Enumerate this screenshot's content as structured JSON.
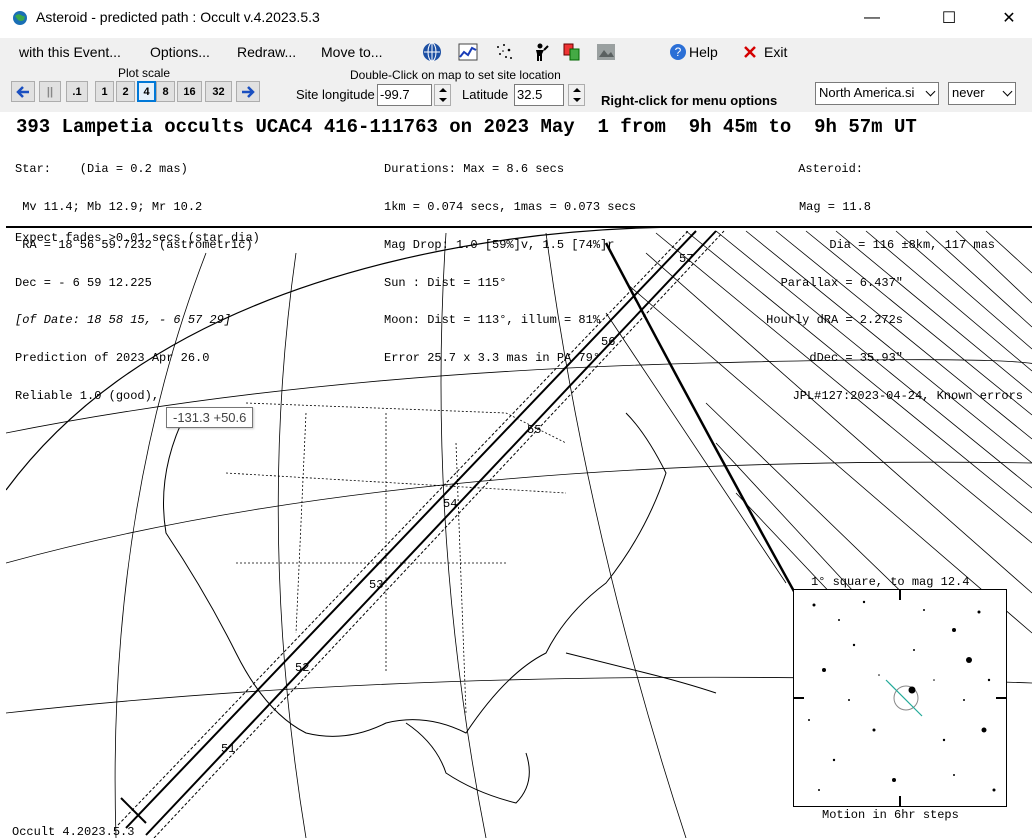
{
  "window": {
    "title": "Asteroid - predicted path : Occult v.4.2023.5.3",
    "minimize": "—",
    "maximize": "☐",
    "close": "✕"
  },
  "menu": {
    "items": [
      "with this Event...",
      "Options...",
      "Redraw...",
      "Move to..."
    ],
    "help": "Help",
    "exit": "Exit",
    "icons": [
      "globe-icon",
      "chart-icon",
      "star-field-icon",
      "person-icon",
      "copy-icon",
      "image-icon"
    ]
  },
  "toolbar": {
    "plot_scale_label": "Plot scale",
    "scale_buttons": [
      "||",
      ".1",
      "1",
      "2",
      "4",
      "8",
      "16",
      "32"
    ],
    "selected_scale": "4",
    "dblclick_hint": "Double-Click on map to set site location",
    "site_longitude_label": "Site longitude",
    "site_longitude_value": "-99.7",
    "latitude_label": "Latitude",
    "latitude_value": "32.5",
    "rightclick_hint": "Right-click for menu options",
    "site_file": "North America.si",
    "never_option": "never"
  },
  "event": {
    "headline": "393 Lampetia occults UCAC4 416-111763 on 2023 May  1 from  9h 45m to  9h 57m UT",
    "star_col": [
      "Star:    (Dia = 0.2 mas)",
      " Mv 11.4; Mb 12.9; Mr 10.2",
      " RA = 18 56 59.7232 (astrometric)",
      "Dec = - 6 59 12.225",
      "[of Date: 18 58 15, - 6 57 29]",
      "Prediction of 2023 Apr 26.0",
      "Reliable 1.0 (good),"
    ],
    "mid_col": [
      "Durations: Max = 8.6 secs",
      "1km = 0.074 secs, 1mas = 0.073 secs",
      "Mag Drop: 1.0 [59%]v, 1.5 [74%]r",
      "Sun : Dist = 115°",
      "Moon: Dist = 113°, illum = 81%",
      "Error 25.7 x 3.3 mas in PA 79°"
    ],
    "ast_col": [
      "Asteroid:",
      "Mag = 11.8",
      "Dia = 116 ±8km, 117 mas",
      "Parallax = 6.437\"",
      "Hourly dRA = 2.272s",
      "dDec = 35.93\"",
      "JPL#127:2023-04-24, Known errors"
    ],
    "fade_note": "Expect fades >0.01 secs (star dia)"
  },
  "map": {
    "tooltip": "-131.3  +50.6",
    "time_labels": [
      "57",
      "56",
      "55",
      "54",
      "53",
      "52",
      "51"
    ],
    "inset_title": "1° square, to mag 12.4",
    "inset_caption": "Motion in 6hr steps",
    "footer": "Occult 4.2023.5.3"
  }
}
